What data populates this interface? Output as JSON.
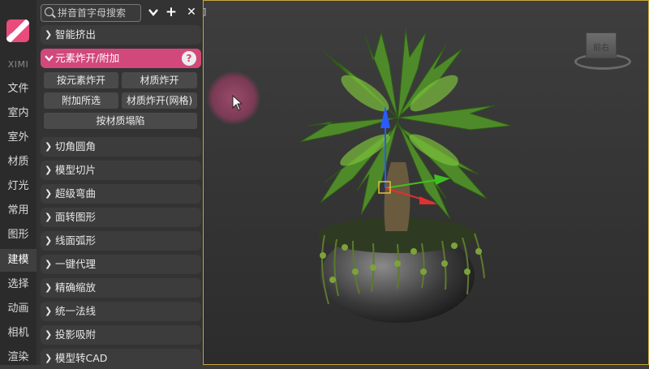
{
  "brand": "XIMI",
  "search": {
    "placeholder": "拼音首字母搜索"
  },
  "toolbar": {
    "add_label": "+",
    "close_label": "✕"
  },
  "rail_items": [
    "文件",
    "室内",
    "室外",
    "材质",
    "灯光",
    "常用",
    "图形",
    "建模",
    "选择",
    "动画",
    "相机",
    "渲染"
  ],
  "rail_active": "建模",
  "sections": [
    "智能挤出",
    "元素炸开/附加",
    "切角圆角",
    "模型切片",
    "超级弯曲",
    "面转图形",
    "线面弧形",
    "一键代理",
    "精确缩放",
    "统一法线",
    "投影吸附",
    "模型转CAD"
  ],
  "open_section": "元素炸开/附加",
  "help_label": "?",
  "sub_buttons": {
    "explode_by_element": "按元素炸开",
    "material_explode": "材质炸开",
    "attach_selected": "附加所选",
    "material_explode_grid": "材质炸开(网格)",
    "collapse_by_material": "按材质塌陷"
  },
  "viewport": {
    "corner_mark": "]",
    "viewcube_label": "前右",
    "accent_border": "#c8a640"
  },
  "colors": {
    "accent": "#d2487a",
    "panel": "#333333",
    "rail": "#2b2b2b"
  }
}
